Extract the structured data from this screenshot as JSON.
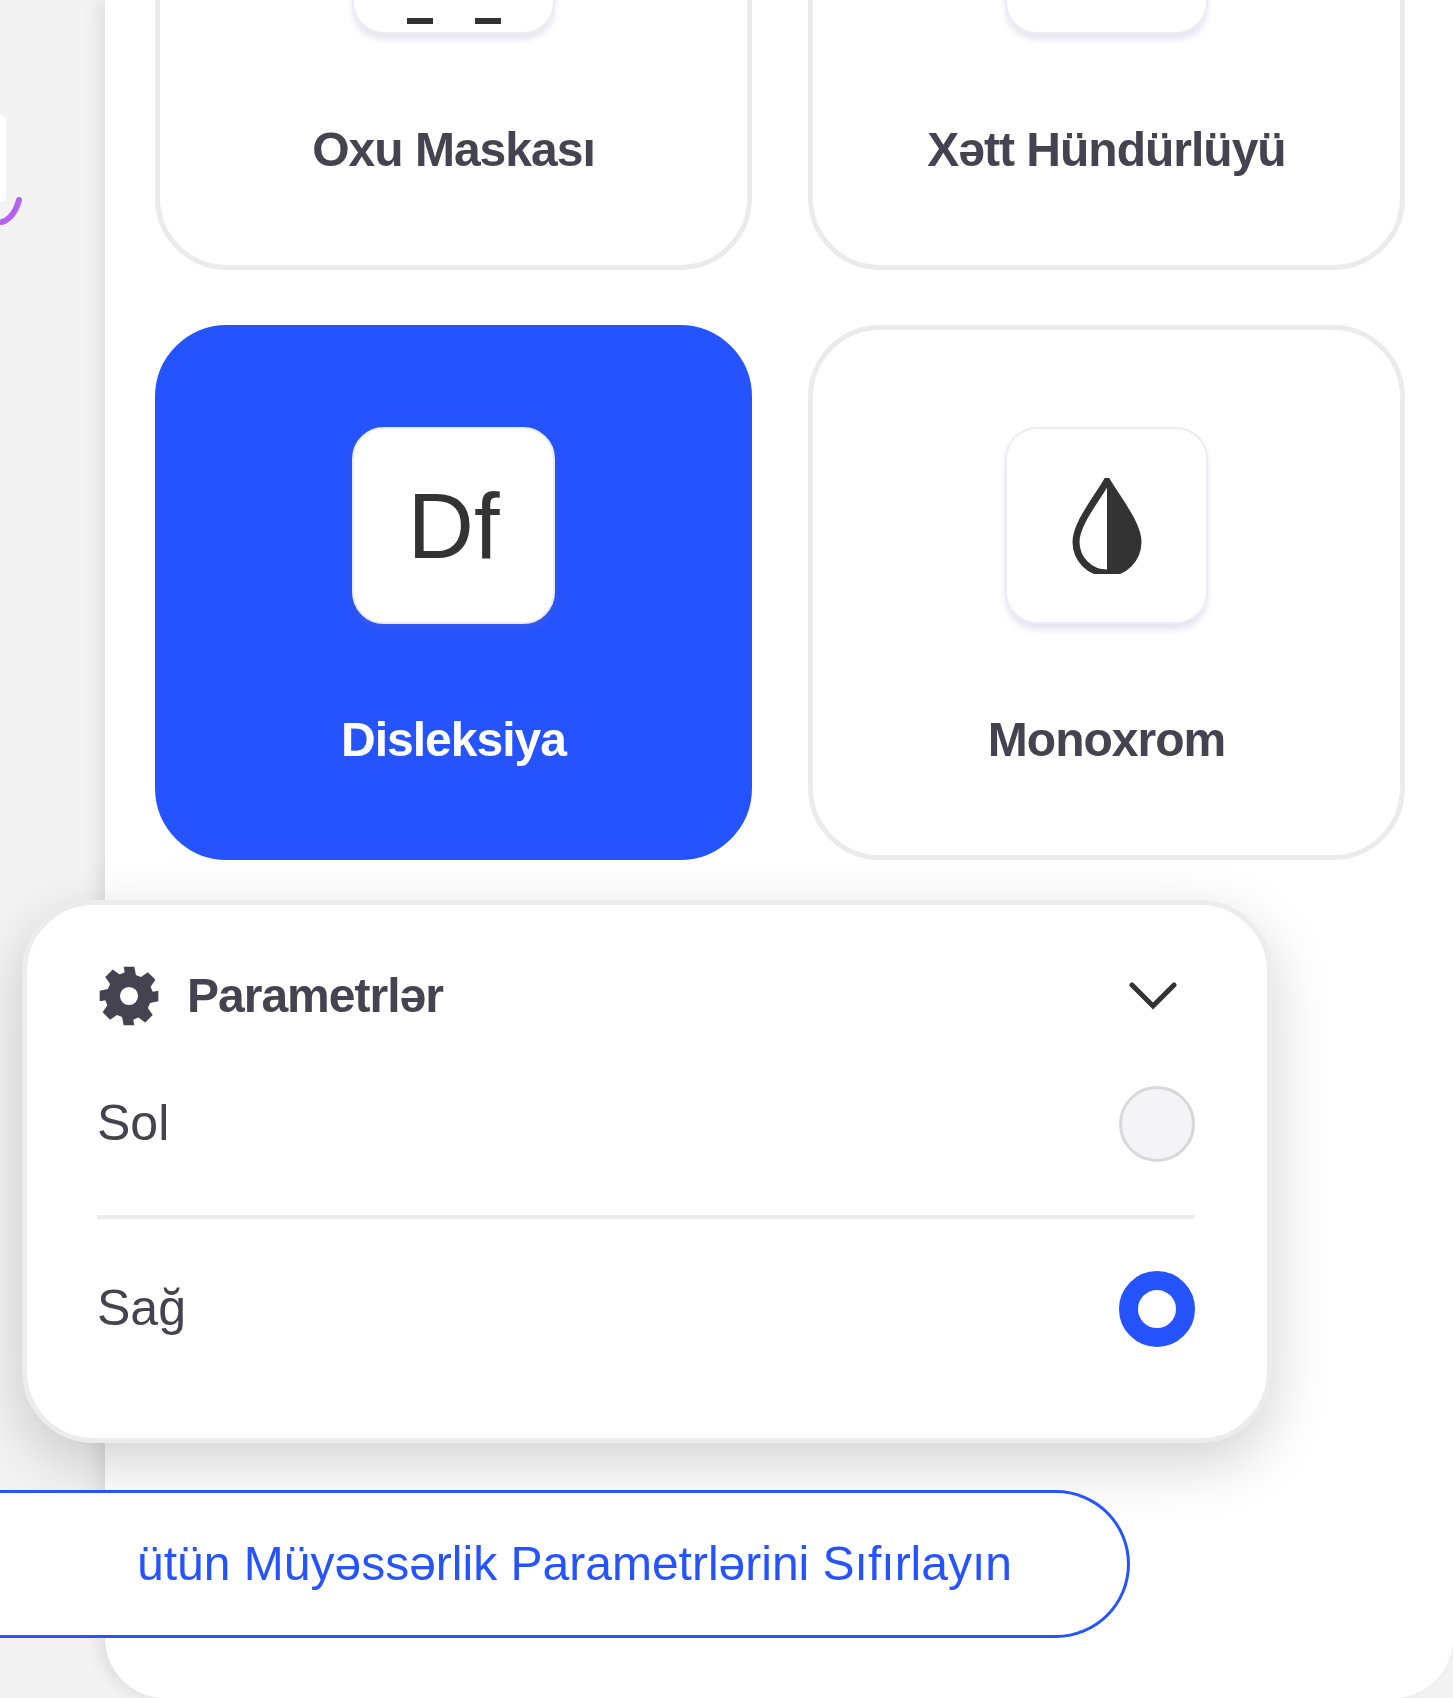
{
  "features": [
    {
      "label": "Oxu Maskası",
      "kind": "mask",
      "selected": false
    },
    {
      "label": "Xətt Hündürlüyü",
      "kind": "spacing",
      "selected": false
    },
    {
      "label": "Disleksiya",
      "kind": "font",
      "icon_text": "Df",
      "selected": true
    },
    {
      "label": "Monoxrom",
      "kind": "mono",
      "selected": false
    }
  ],
  "settings": {
    "title": "Parametrlər",
    "expanded": true,
    "options": [
      {
        "label": "Sol",
        "selected": false
      },
      {
        "label": "Sağ",
        "selected": true
      }
    ]
  },
  "reset_button": "ütün Müyəssərlik Parametrlərini Sıfırlayın"
}
